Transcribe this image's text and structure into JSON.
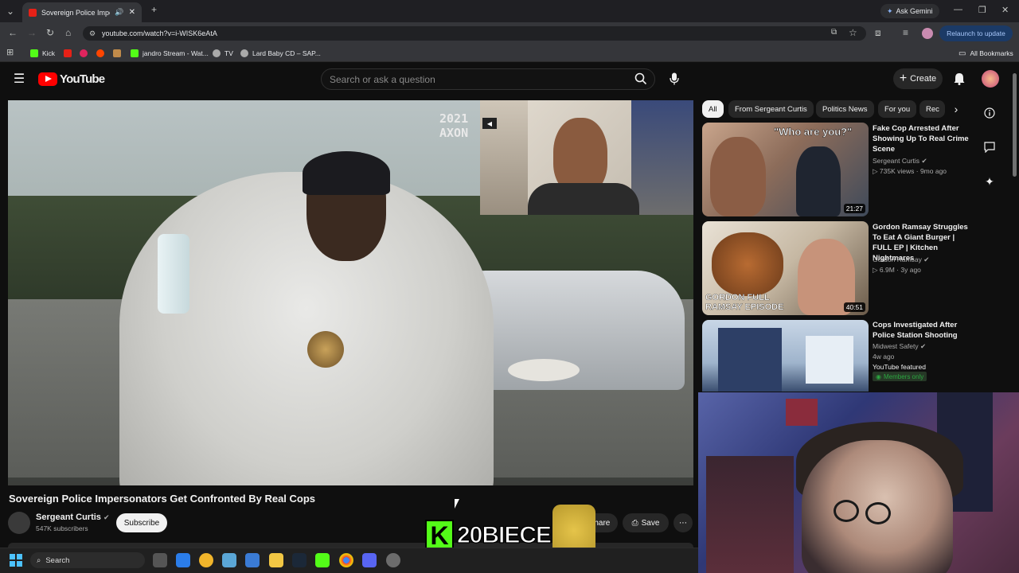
{
  "browser": {
    "tab_title": "Sovereign Police Impersona",
    "url": "youtube.com/watch?v=i-WISK6eAtA",
    "ask_gemini": "Ask Gemini",
    "relaunch": "Relaunch to update",
    "bookmarks": [
      {
        "label": "Kick",
        "color": "#53fc18"
      },
      {
        "label": "",
        "color": "#e62117"
      },
      {
        "label": "",
        "color": "#e0245e"
      },
      {
        "label": "",
        "color": "#ff4500"
      },
      {
        "label": "",
        "color": "#c08a4a"
      },
      {
        "label": "jandro Stream - Wat...",
        "color": "#53fc18"
      },
      {
        "label": "TV",
        "color": "#aaaaaa"
      },
      {
        "label": "Lard Baby CD – SAP...",
        "color": "#aaaaaa"
      }
    ],
    "all_bookmarks": "All Bookmarks"
  },
  "youtube": {
    "logo_text": "YouTube",
    "search_placeholder": "Search or ask a question",
    "create_label": "Create",
    "video": {
      "overlay_text": "2021\nAXON",
      "title": "Sovereign Police Impersonators Get Confronted By Real Cops",
      "channel": "Sergeant Curtis",
      "subscribers": "547K subscribers",
      "subscribe_label": "Subscribe",
      "share_label": "Share",
      "save_label": "Save"
    },
    "chips": [
      "All",
      "From Sergeant Curtis",
      "Politics News",
      "For you",
      "Rec"
    ],
    "recommendations": [
      {
        "title": "Fake Cop Arrested After Showing Up To Real Crime Scene",
        "channel": "Sergeant Curtis",
        "meta": "735K views · 9mo ago",
        "duration": "21:27",
        "thumb_text": "\"Who are you?\""
      },
      {
        "title": "Gordon Ramsay Struggles To Eat A Giant Burger | FULL EP | Kitchen Nightmares",
        "channel": "Gordon Ramsay",
        "meta": "6.9M · 3y ago",
        "duration": "40:51",
        "thumb_text": "GORDON FULL RAMSAY EPISODE"
      },
      {
        "title": "Cops Investigated After Police Station Shooting",
        "channel": "Midwest Safety",
        "meta": "4w ago",
        "extra": "YouTube featured",
        "members": "Members only",
        "duration": "",
        "thumb_text": ""
      }
    ]
  },
  "stream_overlay": {
    "kick_letter": "K",
    "kick_name": "20BIECE"
  },
  "taskbar": {
    "search_label": "Search"
  }
}
